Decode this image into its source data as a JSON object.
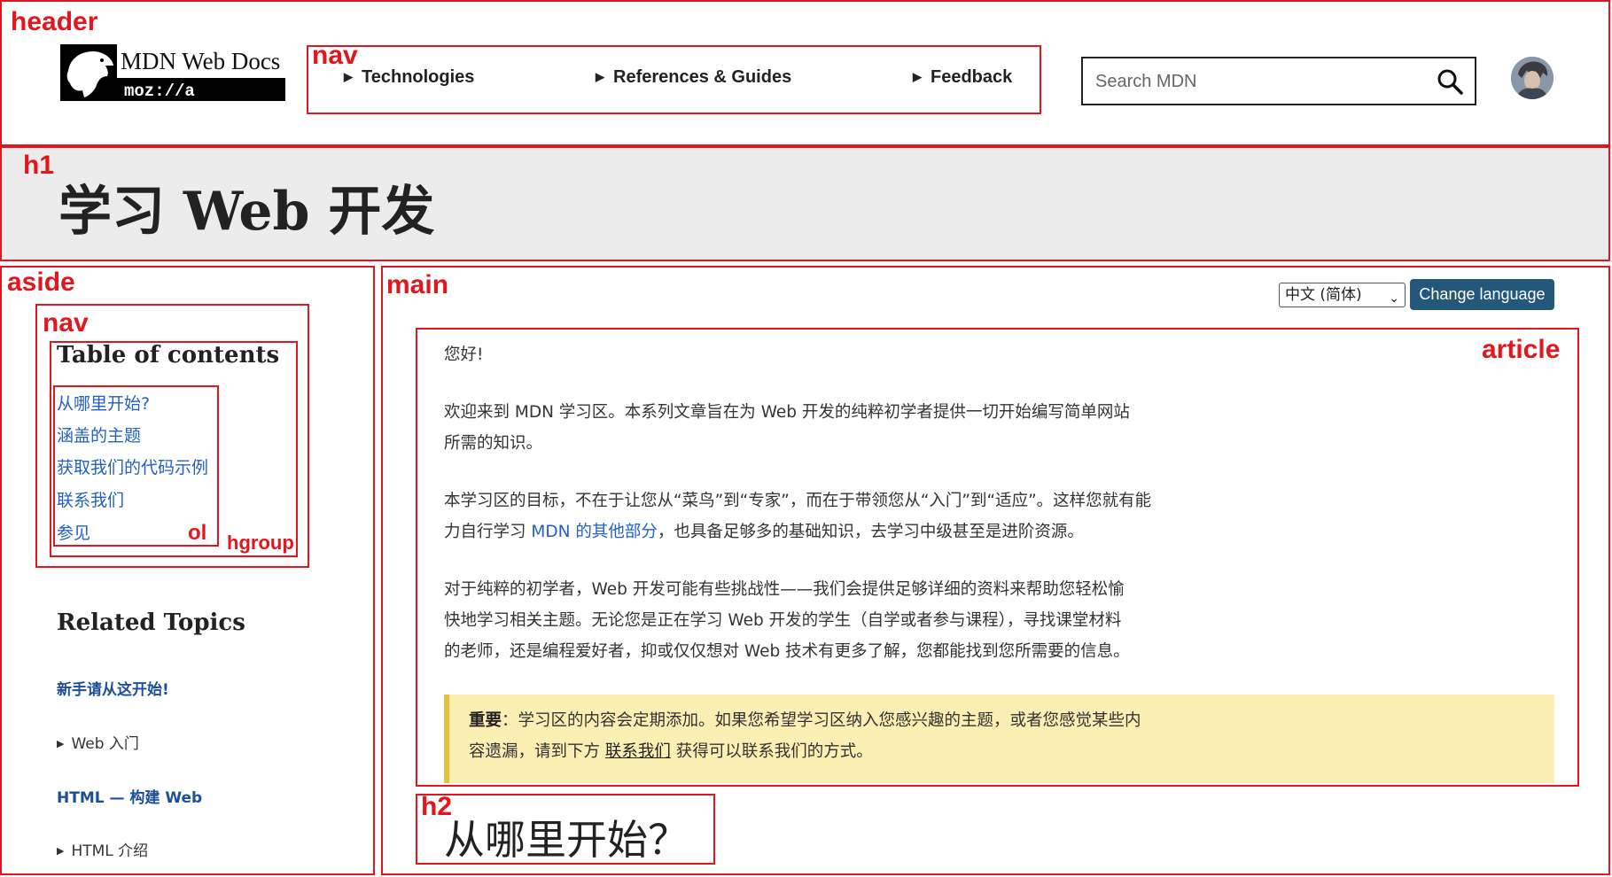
{
  "labels": {
    "header": "header",
    "nav_top": "nav",
    "h1": "h1",
    "aside": "aside",
    "nav_side": "nav",
    "ol": "ol",
    "hgroup": "hgroup",
    "main": "main",
    "article": "article",
    "h2": "h2"
  },
  "logo": {
    "title": "MDN Web Docs",
    "subtitle": "moz://a"
  },
  "nav": {
    "items": [
      "Technologies",
      "References & Guides",
      "Feedback"
    ]
  },
  "search": {
    "placeholder": "Search MDN"
  },
  "page": {
    "title": "学习 Web 开发"
  },
  "toc": {
    "title": "Table of contents",
    "items": [
      "从哪里开始?",
      "涵盖的主题",
      "获取我们的代码示例",
      "联系我们",
      "参见"
    ]
  },
  "related": {
    "title": "Related Topics",
    "link1": "新手请从这开始!",
    "item1": "Web 入门",
    "link2": "HTML — 构建 Web",
    "item2": "HTML 介绍"
  },
  "language": {
    "selected": "中文 (简体)",
    "button": "Change language"
  },
  "article": {
    "greeting": "您好!",
    "p1_line1": "欢迎来到 MDN 学习区。本系列文章旨在为 Web 开发的纯粹初学者提供一切开始编写简单网站",
    "p1_line2": "所需的知识。",
    "p2_line1": "本学习区的目标，不在于让您从“菜鸟”到“专家”，而在于带领您从“入门”到“适应”。这样您就有能",
    "p2_line2_pre": "力自行学习 ",
    "p2_line2_link": "MDN 的其他部分",
    "p2_line2_post": "，也具备足够多的基础知识，去学习中级甚至是进阶资源。",
    "p3_line1": "对于纯粹的初学者，Web 开发可能有些挑战性——我们会提供足够详细的资料来帮助您轻松愉",
    "p3_line2": "快地学习相关主题。无论您是正在学习 Web 开发的学生（自学或者参与课程），寻找课堂材料",
    "p3_line3": "的老师，还是编程爱好者，抑或仅仅想对 Web 技术有更多了解，您都能找到您所需要的信息。",
    "note_bold": "重要",
    "note_line1": "：学习区的内容会定期添加。如果您希望学习区纳入您感兴趣的主题，或者您感觉某些内",
    "note_line2_pre": "容遗漏，请到下方 ",
    "note_line2_link": "联系我们",
    "note_line2_post": " 获得可以联系我们的方式。"
  },
  "section": {
    "h2": "从哪里开始？"
  },
  "colors": {
    "annotation": "#e3161e",
    "link": "#2260c4",
    "button": "#23587a",
    "note_bg": "#fcefb4",
    "note_border": "#e8c03c"
  }
}
